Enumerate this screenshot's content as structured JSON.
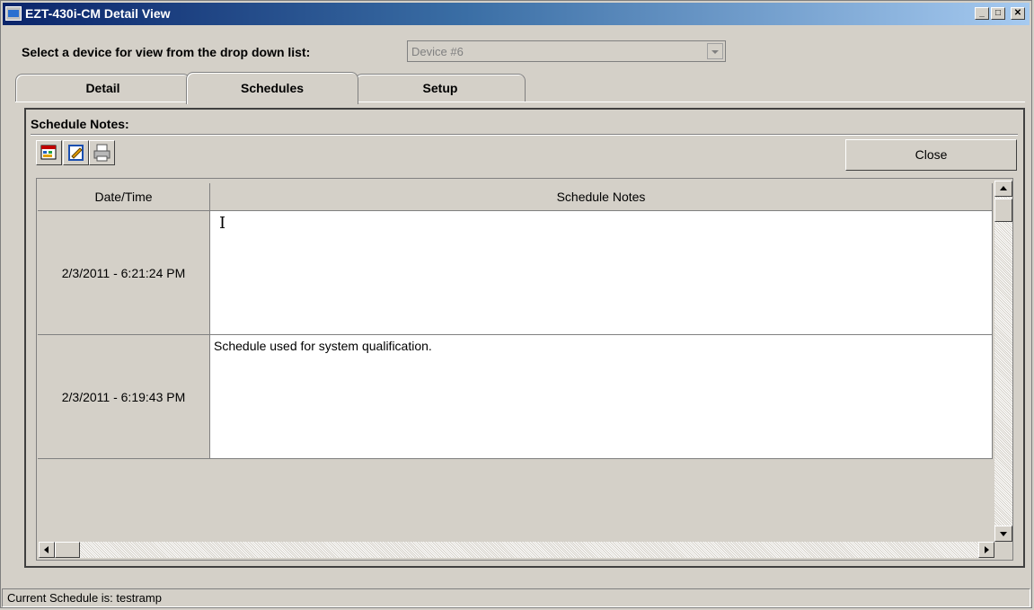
{
  "window": {
    "title": "EZT-430i-CM Detail View",
    "min_glyph": "_",
    "max_glyph": "□",
    "close_glyph": "✕"
  },
  "device_select": {
    "label": "Select a device for view from the drop down list:",
    "value": "Device #6"
  },
  "tabs": [
    {
      "label": "Detail"
    },
    {
      "label": "Schedules",
      "active": true
    },
    {
      "label": "Setup"
    }
  ],
  "panel": {
    "title": "Schedule Notes:",
    "toolbar": {
      "icons": [
        "new-schedule-icon",
        "edit-note-icon",
        "print-icon"
      ],
      "close_label": "Close"
    },
    "table": {
      "columns": [
        "Date/Time",
        "Schedule Notes"
      ],
      "rows": [
        {
          "datetime": "2/3/2011 - 6:21:24 PM",
          "note": ""
        },
        {
          "datetime": "2/3/2011 - 6:19:43 PM",
          "note": "Schedule used for system qualification."
        }
      ]
    }
  },
  "status_bar": {
    "text": "Current Schedule is: testramp"
  },
  "colors": {
    "title_start": "#0a246a",
    "title_end": "#a6caf0",
    "face": "#d4d0c8"
  }
}
